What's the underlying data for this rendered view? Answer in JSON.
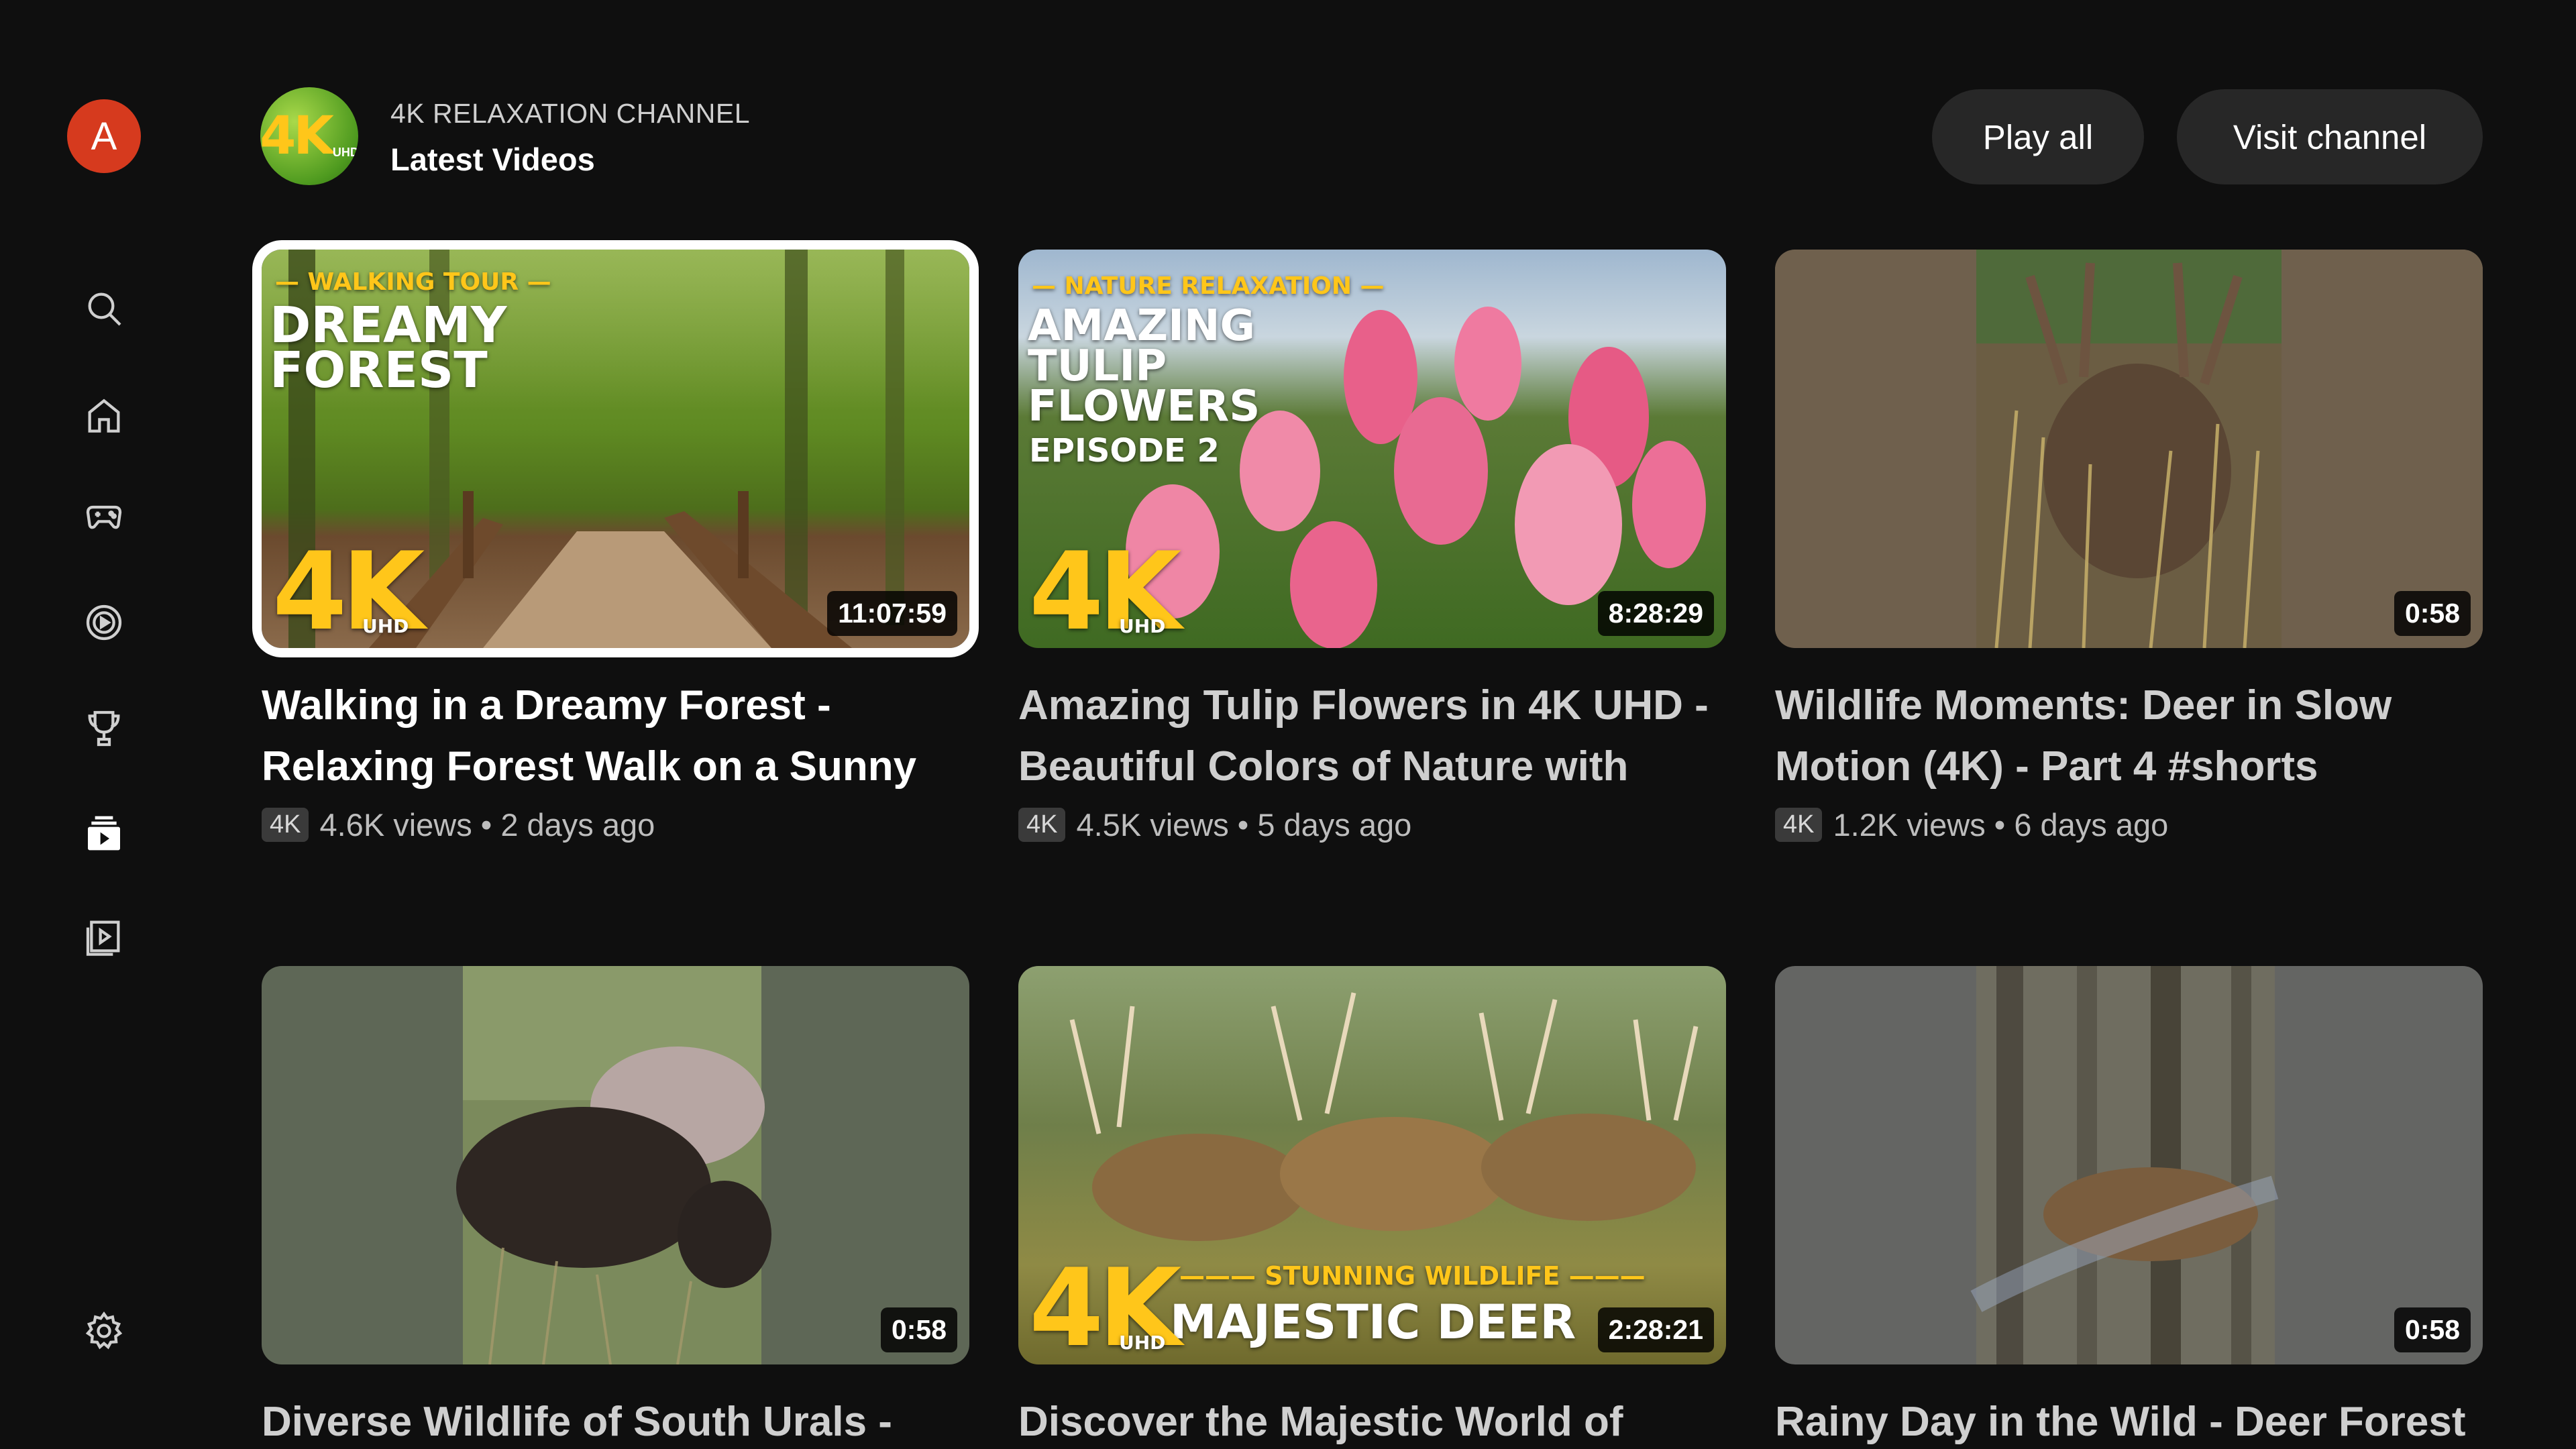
{
  "sidebar": {
    "avatar_letter": "A",
    "avatar_color": "#d63a1e",
    "icons": [
      "search-icon",
      "home-icon",
      "gaming-icon",
      "music-icon",
      "trophy-icon",
      "subscriptions-icon",
      "library-icon",
      "settings-icon"
    ]
  },
  "header": {
    "channel_name": "4K RELAXATION CHANNEL",
    "section_title": "Latest Videos",
    "channel_logo_text": "4K",
    "channel_logo_sub": "UHD",
    "play_all_label": "Play all",
    "visit_channel_label": "Visit channel"
  },
  "videos": [
    {
      "title": "Walking in a Dreamy Forest - Relaxing Forest Walk on a Sunny",
      "duration": "11:07:59",
      "badge": "4K",
      "meta": "4.6K views • 2 days ago",
      "overlay_small": "— WALKING TOUR —",
      "overlay_big_1": "DREAMY",
      "overlay_big_2": "FOREST",
      "logo_4k": "4K",
      "logo_uhd": "UHD"
    },
    {
      "title": "Amazing Tulip Flowers in 4K UHD - Beautiful Colors of Nature with",
      "duration": "8:28:29",
      "badge": "4K",
      "meta": "4.5K views • 5 days ago",
      "overlay_small": "— NATURE RELAXATION —",
      "overlay_big_1": "AMAZING",
      "overlay_big_2": "TULIP",
      "overlay_big_3": "FLOWERS",
      "overlay_big_4": "EPISODE 2",
      "logo_4k": "4K",
      "logo_uhd": "UHD"
    },
    {
      "title": "Wildlife Moments: Deer in Slow Motion (4K) - Part 4 #shorts",
      "duration": "0:58",
      "badge": "4K",
      "meta": "1.2K views • 6 days ago"
    },
    {
      "title": "Diverse Wildlife of South Urals -",
      "duration": "0:58"
    },
    {
      "title": "Discover the Majestic World of",
      "duration": "2:28:21",
      "overlay_small": "——— STUNNING WILDLIFE ———",
      "overlay_big_1": "MAJESTIC DEER",
      "logo_4k": "4K",
      "logo_uhd": "UHD"
    },
    {
      "title": "Rainy Day in the Wild - Deer Forest",
      "duration": "0:58"
    }
  ]
}
